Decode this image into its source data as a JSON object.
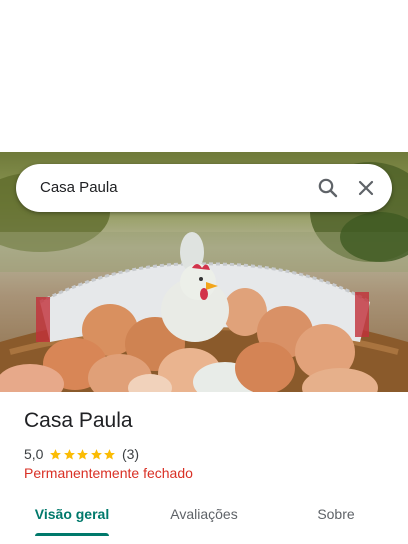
{
  "search": {
    "query": "Casa Paula"
  },
  "place": {
    "title": "Casa Paula",
    "rating": "5,0",
    "stars": 5,
    "review_count": "(3)",
    "status": "Permanentemente fechado"
  },
  "tabs": [
    {
      "label": "Visão geral",
      "selected": true
    },
    {
      "label": "Avaliações",
      "selected": false
    },
    {
      "label": "Sobre",
      "selected": false
    }
  ],
  "colors": {
    "accent": "#00796b",
    "status_closed": "#d93025",
    "star": "#fbbc04"
  },
  "icons": {
    "search": "search-icon",
    "close": "close-icon",
    "star": "star-icon"
  }
}
